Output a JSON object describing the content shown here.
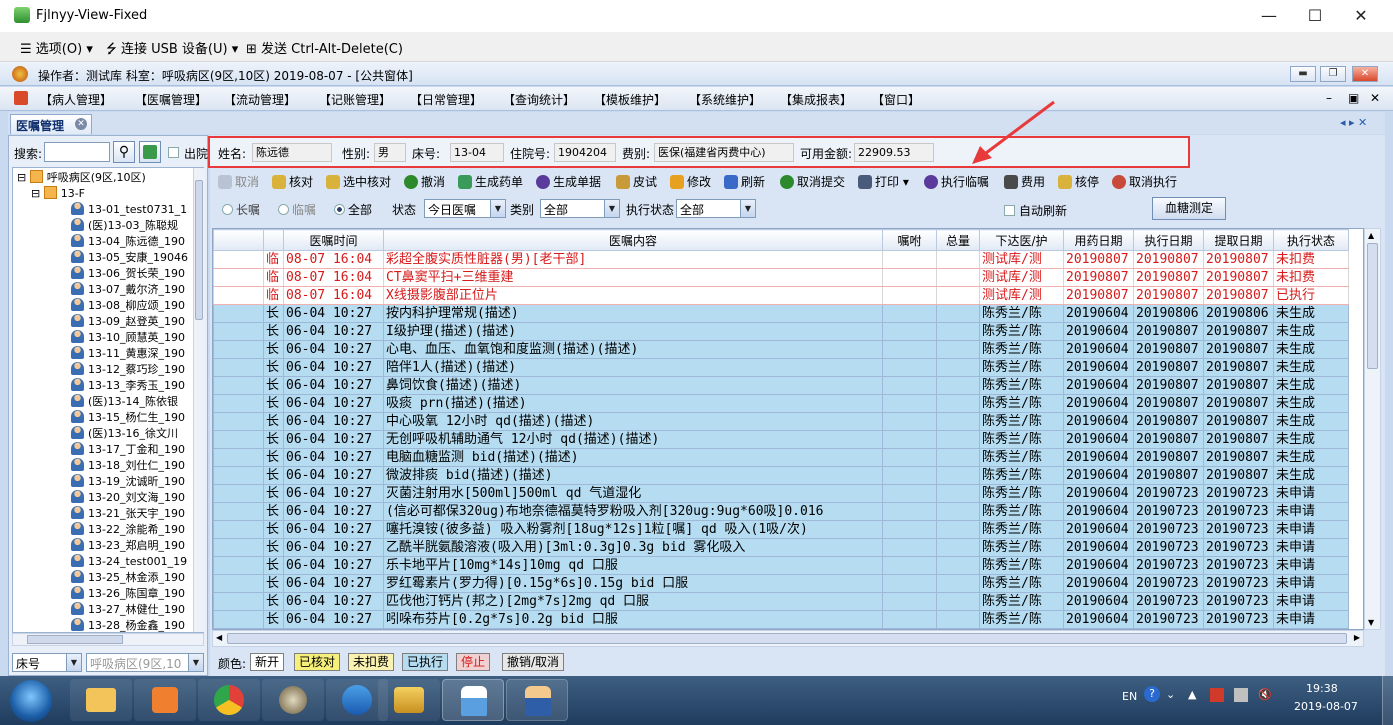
{
  "window": {
    "title": "Fjlnyy-View-Fixed",
    "controls": [
      "—",
      "☐",
      "✕"
    ]
  },
  "vm_menu": {
    "items": [
      "选项(O)",
      "连接 USB 设备(U)",
      "发送 Ctrl-Alt-Delete(C)"
    ]
  },
  "app_status": {
    "text": "操作者：测试库  科室：呼吸病区(9区,10区)  2019-08-07 - [公共窗体]"
  },
  "main_menu": [
    "【病人管理】",
    "【医嘱管理】",
    "【流动管理】",
    "【记账管理】",
    "【日常管理】",
    "【查询统计】",
    "【模板维护】",
    "【系统维护】",
    "【集成报表】",
    "【窗口】"
  ],
  "tab": {
    "label": "医嘱管理"
  },
  "left": {
    "search_label": "搜索:",
    "discharged_label": "出院",
    "tree_root": "呼吸病区(9区,10区)",
    "tree_ward": "13-F",
    "patients": [
      "13-01_test0731_1",
      "(医)13-03_陈聪规",
      "13-04_陈远德_190",
      "13-05_安康_19046",
      "13-06_贺长荣_190",
      "13-07_戴尔济_190",
      "13-08_柳应颂_190",
      "13-09_赵登英_190",
      "13-10_顾慧英_190",
      "13-11_黄惠深_190",
      "13-12_蔡巧珍_190",
      "13-13_李秀玉_190",
      "(医)13-14_陈依银",
      "13-15_杨仁生_190",
      "(医)13-16_徐文川",
      "13-17_丁金和_190",
      "13-18_刘仕仁_190",
      "13-19_沈诚昕_190",
      "13-20_刘文海_190",
      "13-21_张天宇_190",
      "13-22_涂能希_190",
      "13-23_郑启明_190",
      "13-24_test001_19",
      "13-25_林金添_190",
      "13-26_陈国章_190",
      "13-27_林健仕_190",
      "13-28_杨金鑫_190"
    ],
    "sort_value": "床号",
    "ward_value": "呼吸病区(9区,10"
  },
  "patient": {
    "name_label": "姓名:",
    "name": "陈远德",
    "sex_label": "性别:",
    "sex": "男",
    "bed_label": "床号:",
    "bed": "13-04",
    "inpatient_label": "住院号:",
    "inpatient_no": "1904204",
    "fee_label": "费别:",
    "fee_type": "医保(福建省丙费中心)",
    "balance_label": "可用金额:",
    "balance": "22909.53"
  },
  "toolbar": [
    "取消",
    "核对",
    "选中核对",
    "撤消",
    "生成药单",
    "生成单据",
    "皮试",
    "修改",
    "刷新",
    "取消提交",
    "打印",
    "执行临嘱",
    "费用",
    "核停",
    "取消执行"
  ],
  "filters": {
    "r_long": "长嘱",
    "r_temp": "临嘱",
    "r_all": "全部",
    "status_label": "状态",
    "status_value": "今日医嘱",
    "category_label": "类别",
    "category_value": "全部",
    "exec_label": "执行状态",
    "exec_value": "全部",
    "auto_refresh": "自动刷新",
    "blood_sugar": "血糖测定"
  },
  "grid": {
    "headers": [
      "",
      "",
      "医嘱时间",
      "医嘱内容",
      "嘱咐",
      "总量",
      "下达医/护",
      "用药日期",
      "执行日期",
      "提取日期",
      "执行状态"
    ],
    "rows": [
      {
        "style": "red",
        "cells": [
          "",
          "临",
          "08-07 16:04",
          "彩超全腹实质性脏器(男)[老干部]",
          "",
          "",
          "测试库/测",
          "20190807",
          "20190807",
          "20190807",
          "未扣费"
        ]
      },
      {
        "style": "red",
        "cells": [
          "",
          "临",
          "08-07 16:04",
          "CT鼻窦平扫+三维重建",
          "",
          "",
          "测试库/测",
          "20190807",
          "20190807",
          "20190807",
          "未扣费"
        ]
      },
      {
        "style": "red",
        "cells": [
          "",
          "临",
          "08-07 16:04",
          "X线摄影腹部正位片",
          "",
          "",
          "测试库/测",
          "20190807",
          "20190807",
          "20190807",
          "已执行"
        ]
      },
      {
        "style": "blue",
        "cells": [
          "",
          "长",
          "06-04 10:27",
          "按内科护理常规(描述)",
          "",
          "",
          "陈秀兰/陈",
          "20190604",
          "20190806",
          "20190806",
          "未生成"
        ]
      },
      {
        "style": "blue",
        "cells": [
          "",
          "长",
          "06-04 10:27",
          "I级护理(描述)(描述)",
          "",
          "",
          "陈秀兰/陈",
          "20190604",
          "20190807",
          "20190807",
          "未生成"
        ]
      },
      {
        "style": "blue",
        "cells": [
          "",
          "长",
          "06-04 10:27",
          "心电、血压、血氧饱和度监测(描述)(描述)",
          "",
          "",
          "陈秀兰/陈",
          "20190604",
          "20190807",
          "20190807",
          "未生成"
        ]
      },
      {
        "style": "blue",
        "cells": [
          "",
          "长",
          "06-04 10:27",
          "陪伴1人(描述)(描述)",
          "",
          "",
          "陈秀兰/陈",
          "20190604",
          "20190807",
          "20190807",
          "未生成"
        ]
      },
      {
        "style": "blue",
        "cells": [
          "",
          "长",
          "06-04 10:27",
          "鼻饲饮食(描述)(描述)",
          "",
          "",
          "陈秀兰/陈",
          "20190604",
          "20190807",
          "20190807",
          "未生成"
        ]
      },
      {
        "style": "blue",
        "cells": [
          "",
          "长",
          "06-04 10:27",
          "吸痰 prn(描述)(描述)",
          "",
          "",
          "陈秀兰/陈",
          "20190604",
          "20190807",
          "20190807",
          "未生成"
        ]
      },
      {
        "style": "blue",
        "cells": [
          "",
          "长",
          "06-04 10:27",
          "中心吸氧 12小时 qd(描述)(描述)",
          "",
          "",
          "陈秀兰/陈",
          "20190604",
          "20190807",
          "20190807",
          "未生成"
        ]
      },
      {
        "style": "blue",
        "cells": [
          "",
          "长",
          "06-04 10:27",
          "无创呼吸机辅助通气 12小时 qd(描述)(描述)",
          "",
          "",
          "陈秀兰/陈",
          "20190604",
          "20190807",
          "20190807",
          "未生成"
        ]
      },
      {
        "style": "blue",
        "cells": [
          "",
          "长",
          "06-04 10:27",
          "电脑血糖监测 bid(描述)(描述)",
          "",
          "",
          "陈秀兰/陈",
          "20190604",
          "20190807",
          "20190807",
          "未生成"
        ]
      },
      {
        "style": "blue",
        "cells": [
          "",
          "长",
          "06-04 10:27",
          "微波排痰 bid(描述)(描述)",
          "",
          "",
          "陈秀兰/陈",
          "20190604",
          "20190807",
          "20190807",
          "未生成"
        ]
      },
      {
        "style": "blue",
        "cells": [
          "",
          "长",
          "06-04 10:27",
          "灭菌注射用水[500ml]500ml qd 气道湿化",
          "",
          "",
          "陈秀兰/陈",
          "20190604",
          "20190723",
          "20190723",
          "未申请"
        ]
      },
      {
        "style": "blue",
        "cells": [
          "",
          "长",
          "06-04 10:27",
          "(信必可都保320ug)布地奈德福莫特罗粉吸入剂[320ug:9ug*60吸]0.016",
          "",
          "",
          "陈秀兰/陈",
          "20190604",
          "20190723",
          "20190723",
          "未申请"
        ]
      },
      {
        "style": "blue",
        "cells": [
          "",
          "长",
          "06-04 10:27",
          "噻托溴铵(彼多益) 吸入粉雾剂[18ug*12s]1粒[嘱] qd 吸入(1吸/次)",
          "",
          "",
          "陈秀兰/陈",
          "20190604",
          "20190723",
          "20190723",
          "未申请"
        ]
      },
      {
        "style": "blue",
        "cells": [
          "",
          "长",
          "06-04 10:27",
          "乙酰半胱氨酸溶液(吸入用)[3ml:0.3g]0.3g bid 雾化吸入",
          "",
          "",
          "陈秀兰/陈",
          "20190604",
          "20190723",
          "20190723",
          "未申请"
        ]
      },
      {
        "style": "blue",
        "cells": [
          "",
          "长",
          "06-04 10:27",
          "乐卡地平片[10mg*14s]10mg qd 口服",
          "",
          "",
          "陈秀兰/陈",
          "20190604",
          "20190723",
          "20190723",
          "未申请"
        ]
      },
      {
        "style": "blue",
        "cells": [
          "",
          "长",
          "06-04 10:27",
          "罗红霉素片(罗力得)[0.15g*6s]0.15g bid 口服",
          "",
          "",
          "陈秀兰/陈",
          "20190604",
          "20190723",
          "20190723",
          "未申请"
        ]
      },
      {
        "style": "blue",
        "cells": [
          "",
          "长",
          "06-04 10:27",
          "匹伐他汀钙片(邦之)[2mg*7s]2mg qd 口服",
          "",
          "",
          "陈秀兰/陈",
          "20190604",
          "20190723",
          "20190723",
          "未申请"
        ]
      },
      {
        "style": "blue",
        "cells": [
          "",
          "长",
          "06-04 10:27",
          "吲哚布芬片[0.2g*7s]0.2g bid 口服",
          "",
          "",
          "陈秀兰/陈",
          "20190604",
          "20190723",
          "20190723",
          "未申请"
        ]
      }
    ]
  },
  "legend": {
    "label": "颜色:",
    "items": [
      "新开",
      "已核对",
      "未扣费",
      "已执行",
      "停止",
      "撤销/取消"
    ]
  },
  "taskbar": {
    "ime": "EN",
    "time": "19:38",
    "date": "2019-08-07"
  },
  "colors": {
    "highlight_box": "#e83a3a",
    "red_rows": "#d81a1a",
    "blue_rows": "#b5dcf1"
  }
}
